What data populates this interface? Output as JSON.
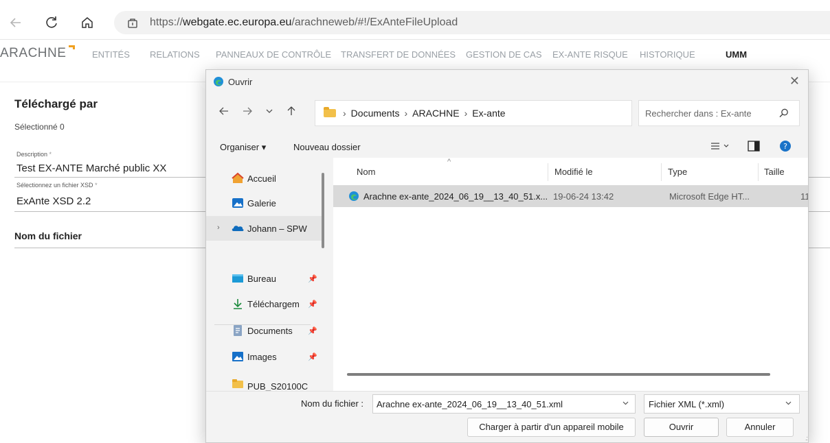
{
  "browser": {
    "url_scheme": "https://",
    "url_host": "webgate.ec.europa.eu",
    "url_path": "/arachneweb/#!/ExAnteFileUpload",
    "back_icon": "back-arrow-icon",
    "reload_icon": "reload-icon",
    "home_icon": "home-icon",
    "site_info_icon": "site-info-icon"
  },
  "app_nav": {
    "brand": "ARACHNE",
    "items": [
      "ENTITÉS",
      "RELATIONS",
      "PANNEAUX DE CONTRÔLE",
      "TRANSFERT DE DONNÉES",
      "GESTION DE CAS",
      "EX-ANTE RISQUE",
      "HISTORIQUE"
    ],
    "user": "UMM"
  },
  "page": {
    "title": "Téléchargé par",
    "subtitle": "Sélectionné 0",
    "description_label": "Description",
    "description_value": "Test EX-ANTE Marché public XX",
    "xsd_label": "Sélectionnez un fichier XSD",
    "xsd_value": "ExAnte XSD 2.2",
    "required_mark": "*",
    "filename_heading": "Nom du fichier"
  },
  "dialog": {
    "title": "Ouvrir",
    "close": "✕",
    "path": [
      "Documents",
      "ARACHNE",
      "Ex-ante"
    ],
    "search_placeholder": "Rechercher dans : Ex-ante",
    "organise": "Organiser ▾",
    "new_folder": "Nouveau dossier",
    "left_items": [
      {
        "label": "Accueil",
        "icon": "home-icon"
      },
      {
        "label": "Galerie",
        "icon": "gallery-icon"
      },
      {
        "label": "Johann – SPW",
        "icon": "onedrive-cloud-icon"
      },
      {
        "label": "Bureau",
        "icon": "desktop-icon"
      },
      {
        "label": "Téléchargem",
        "icon": "download-icon"
      },
      {
        "label": "Documents",
        "icon": "document-icon"
      },
      {
        "label": "Images",
        "icon": "pictures-icon"
      },
      {
        "label": "PUB_S20100C",
        "icon": "folder-icon"
      }
    ],
    "columns": [
      "Nom",
      "Modifié le",
      "Type",
      "Taille"
    ],
    "files": [
      {
        "name": "Arachne ex-ante_2024_06_19__13_40_51.x...",
        "modified": "19-06-24 13:42",
        "type": "Microsoft Edge HT...",
        "size": "11"
      }
    ],
    "filename_label": "Nom du fichier :",
    "filename_value": "Arachne ex-ante_2024_06_19__13_40_51.xml",
    "filetype_value": "Fichier XML (*.xml)",
    "mobile_button": "Charger à partir d'un appareil mobile",
    "open_button": "Ouvrir",
    "cancel_button": "Annuler"
  }
}
